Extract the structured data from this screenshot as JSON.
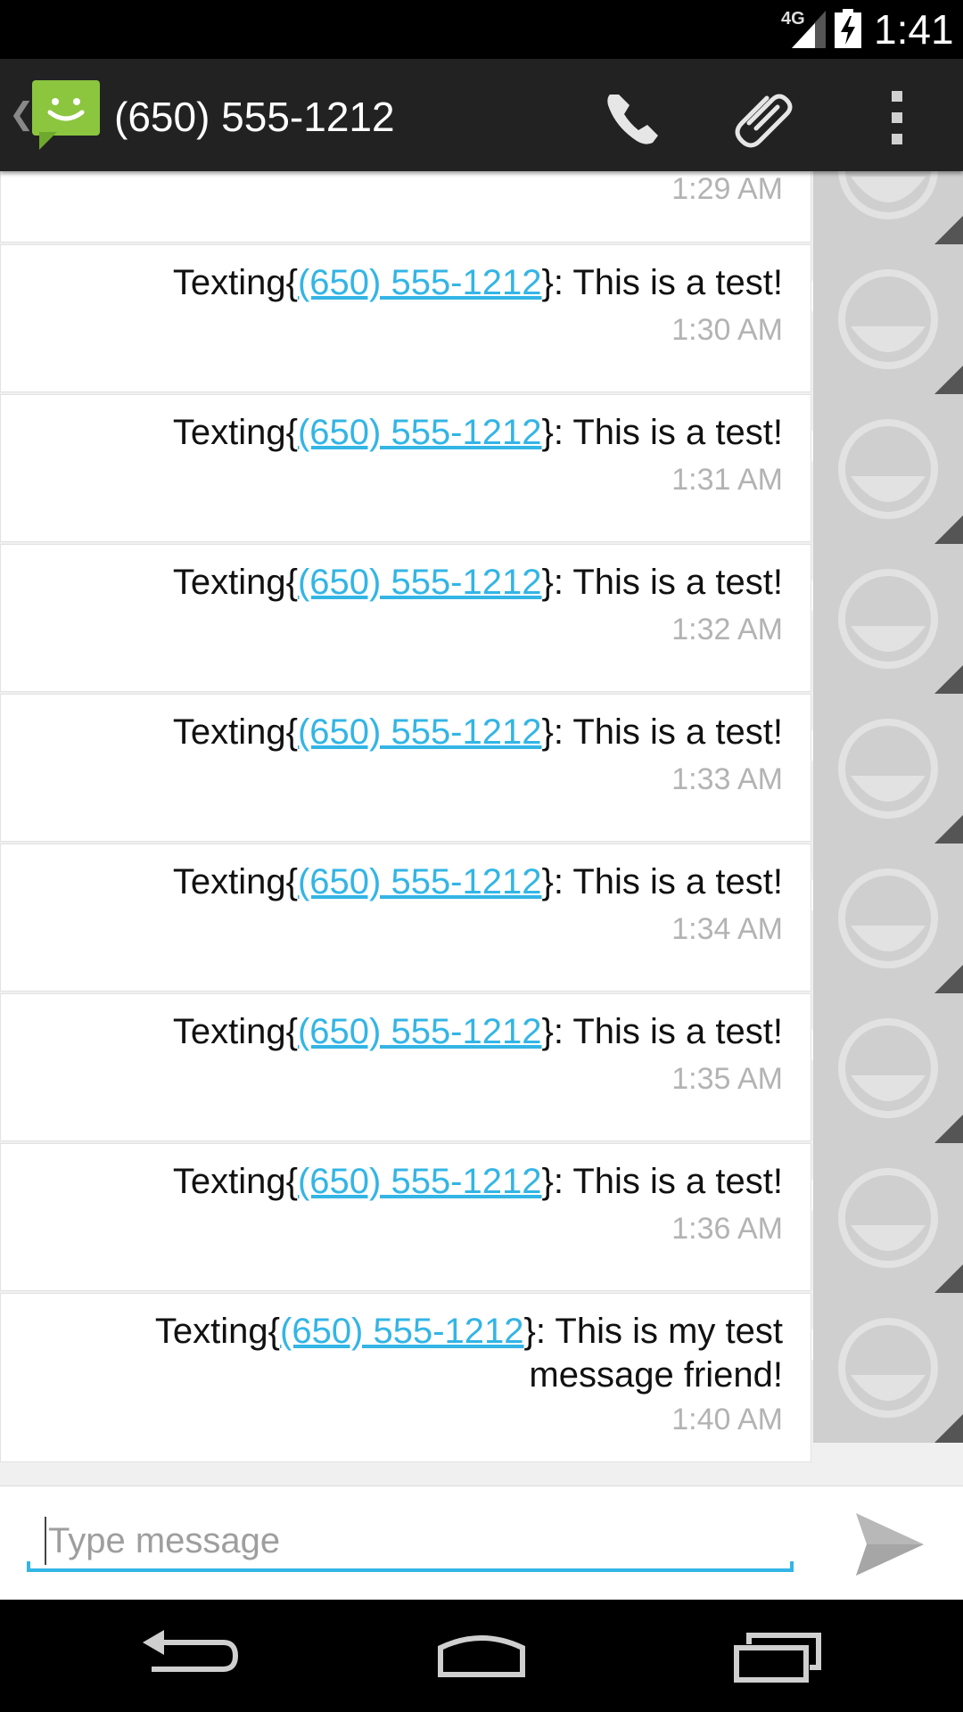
{
  "status_bar": {
    "network": "4G",
    "time": "1:41"
  },
  "action_bar": {
    "title": "(650) 555-1212"
  },
  "messages": [
    {
      "prefix": "",
      "link": "",
      "suffix": "",
      "time": "1:29 AM"
    },
    {
      "prefix": "Texting{",
      "link": "(650) 555-1212",
      "suffix": "}: This is a test!",
      "time": "1:30 AM"
    },
    {
      "prefix": "Texting{",
      "link": "(650) 555-1212",
      "suffix": "}: This is a test!",
      "time": "1:31 AM"
    },
    {
      "prefix": "Texting{",
      "link": "(650) 555-1212",
      "suffix": "}: This is a test!",
      "time": "1:32 AM"
    },
    {
      "prefix": "Texting{",
      "link": "(650) 555-1212",
      "suffix": "}: This is a test!",
      "time": "1:33 AM"
    },
    {
      "prefix": "Texting{",
      "link": "(650) 555-1212",
      "suffix": "}: This is a test!",
      "time": "1:34 AM"
    },
    {
      "prefix": "Texting{",
      "link": "(650) 555-1212",
      "suffix": "}: This is a test!",
      "time": "1:35 AM"
    },
    {
      "prefix": "Texting{",
      "link": "(650) 555-1212",
      "suffix": "}: This is a test!",
      "time": "1:36 AM"
    },
    {
      "prefix": "Texting{",
      "link": "(650) 555-1212",
      "suffix": "}: This is my test message friend!",
      "time": "1:40 AM"
    }
  ],
  "compose": {
    "placeholder": "Type message",
    "value": ""
  },
  "colors": {
    "accent": "#33b5e5",
    "action_bar": "#222222",
    "app_icon": "#8cc63f"
  }
}
